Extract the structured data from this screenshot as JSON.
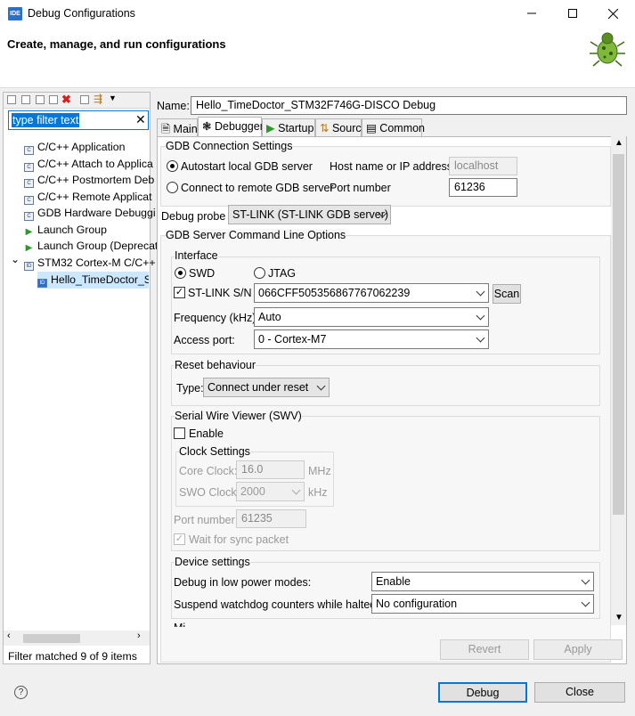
{
  "window": {
    "title": "Debug Configurations",
    "app_icon": "IDE"
  },
  "header": {
    "title": "Create, manage, and run configurations"
  },
  "left": {
    "filter_placeholder": "type filter text",
    "tree": [
      "C/C++ Application",
      "C/C++ Attach to Applica",
      "C/C++ Postmortem Deb",
      "C/C++ Remote Applicat",
      "GDB Hardware Debuggi",
      "Launch Group",
      "Launch Group (Deprecat",
      "STM32 Cortex-M C/C++",
      "Hello_TimeDoctor_ST"
    ],
    "status": "Filter matched 9 of 9 items"
  },
  "config": {
    "name_label": "Name:",
    "name": "Hello_TimeDoctor_STM32F746G-DISCO Debug",
    "tabs": [
      "Main",
      "Debugger",
      "Startup",
      "Source",
      "Common"
    ],
    "gdb": {
      "title": "GDB Connection Settings",
      "autostart": "Autostart local GDB server",
      "connect_remote": "Connect to remote GDB server",
      "host_label": "Host name or IP address",
      "host_value": "localhost",
      "port_label": "Port number",
      "port_value": "61236"
    },
    "probe_label": "Debug probe",
    "probe_value": "ST-LINK (ST-LINK GDB server)",
    "server_title": "GDB Server Command Line Options",
    "interface": {
      "title": "Interface",
      "swd": "SWD",
      "jtag": "JTAG",
      "stlink_label": "ST-LINK S/N",
      "stlink_value": "066CFF505356867767062239",
      "scan": "Scan",
      "freq_label": "Frequency (kHz):",
      "freq_value": "Auto",
      "access_label": "Access port:",
      "access_value": "0 - Cortex-M7"
    },
    "reset": {
      "title": "Reset behaviour",
      "type_label": "Type:",
      "type_value": "Connect under reset"
    },
    "swv": {
      "title": "Serial Wire Viewer (SWV)",
      "enable": "Enable",
      "clock_title": "Clock Settings",
      "core_label": "Core Clock:",
      "core_value": "16.0",
      "core_unit": "MHz",
      "swo_label": "SWO Clock:",
      "swo_value": "2000",
      "swo_unit": "kHz",
      "port_label": "Port number:",
      "port_value": "61235",
      "wait": "Wait for sync packet"
    },
    "device": {
      "title": "Device settings",
      "lowpower_label": "Debug in low power modes:",
      "lowpower_value": "Enable",
      "watchdog_label": "Suspend watchdog counters while halted:",
      "watchdog_value": "No configuration"
    },
    "cut_label": "Mi",
    "revert": "Revert",
    "apply": "Apply"
  },
  "footer": {
    "debug": "Debug",
    "close": "Close"
  }
}
